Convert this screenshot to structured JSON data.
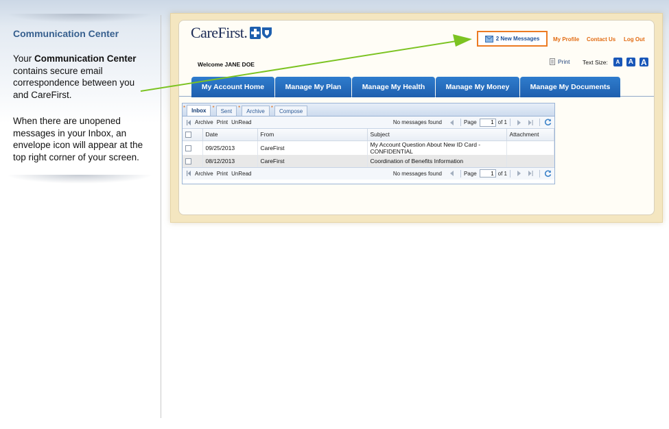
{
  "left_panel": {
    "title": "Communication Center",
    "par1_pre": "Your ",
    "par1_bold": "Communication Center",
    "par1_post": " contains secure email correspondence between you and CareFirst.",
    "par2": "When there are unopened messages in your Inbox, an envelope icon will appear at the top right corner of your screen."
  },
  "header": {
    "logo_text": "CareFirst.",
    "new_messages": "2 New Messages",
    "links": [
      "My Profile",
      "Contact Us",
      "Log Out"
    ],
    "welcome": "Welcome JANE DOE",
    "print": "Print",
    "text_size_label": "Text Size:",
    "text_size_buttons": [
      "A",
      "A",
      "A"
    ]
  },
  "nav": {
    "tabs": [
      "My Account Home",
      "Manage My Plan",
      "Manage My Health",
      "Manage My Money",
      "Manage My Documents"
    ]
  },
  "messages": {
    "tabs": [
      "Inbox",
      "Sent",
      "Archive",
      "Compose"
    ],
    "toolbar": {
      "buttons": [
        "Archive",
        "Print",
        "UnRead"
      ],
      "status": "No messages found",
      "page_label": "Page",
      "page_value": "1",
      "page_of": "of 1"
    },
    "columns": [
      "Date",
      "From",
      "Subject",
      "Attachment"
    ],
    "rows": [
      {
        "date": "09/25/2013",
        "from": "CareFirst",
        "subject": "My Account Question About New ID Card - CONFIDENTIAL",
        "attachment": ""
      },
      {
        "date": "08/12/2013",
        "from": "CareFirst",
        "subject": "Coordination of Benefits Information",
        "attachment": ""
      }
    ]
  },
  "colors": {
    "accent_orange": "#ec7a22",
    "nav_blue": "#1e5fae",
    "arrow_green": "#7cc322",
    "title_blue": "#365f8e"
  }
}
